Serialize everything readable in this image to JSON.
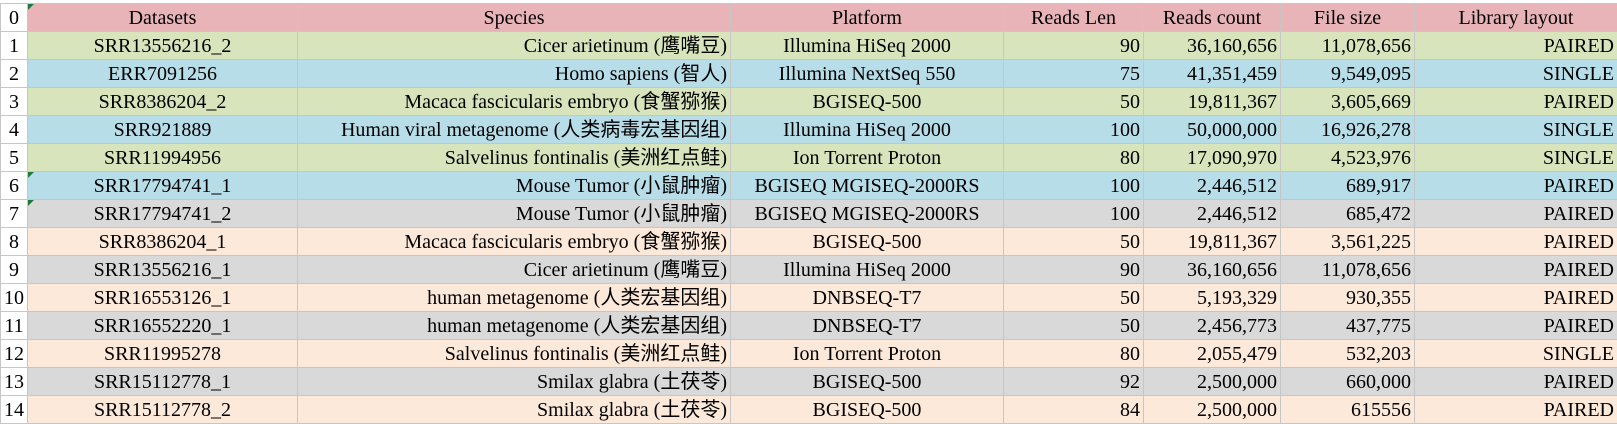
{
  "colors": {
    "header": "#e8b4b8",
    "green": "#d8e4bc",
    "blue": "#b7dde8",
    "gray": "#d9d9d9",
    "peach": "#fde9d9",
    "index": "#ffffff",
    "marker": "#1e7a3a"
  },
  "sheet": {
    "header_index": "0",
    "columns": [
      "Datasets",
      "Species",
      "Platform",
      "Reads Len",
      "Reads count",
      "File size",
      "Library layout"
    ],
    "rows": [
      {
        "index": "1",
        "color": "green",
        "cells": [
          "SRR13556216_2",
          "Cicer arietinum (鹰嘴豆)",
          "Illumina HiSeq 2000",
          "90",
          "36,160,656",
          "11,078,656",
          "PAIRED"
        ]
      },
      {
        "index": "2",
        "color": "blue",
        "cells": [
          "ERR7091256",
          "Homo sapiens (智人)",
          "Illumina NextSeq 550",
          "75",
          "41,351,459",
          "9,549,095",
          "SINGLE"
        ]
      },
      {
        "index": "3",
        "color": "green",
        "cells": [
          "SRR8386204_2",
          "Macaca fascicularis embryo (食蟹猕猴)",
          "BGISEQ-500",
          "50",
          "19,811,367",
          "3,605,669",
          "PAIRED"
        ]
      },
      {
        "index": "4",
        "color": "blue",
        "cells": [
          "SRR921889",
          "Human viral metagenome (人类病毒宏基因组)",
          "Illumina HiSeq 2000",
          "100",
          "50,000,000",
          "16,926,278",
          "SINGLE"
        ]
      },
      {
        "index": "5",
        "color": "green",
        "cells": [
          "SRR11994956",
          "Salvelinus fontinalis (美洲红点鲑)",
          "Ion Torrent Proton",
          "80",
          "17,090,970",
          "4,523,976",
          "SINGLE"
        ]
      },
      {
        "index": "6",
        "color": "blue",
        "cells": [
          "SRR17794741_1",
          "Mouse Tumor (小鼠肿瘤)",
          "BGISEQ MGISEQ-2000RS",
          "100",
          "2,446,512",
          "689,917",
          "PAIRED"
        ]
      },
      {
        "index": "7",
        "color": "gray",
        "cells": [
          "SRR17794741_2",
          "Mouse Tumor (小鼠肿瘤)",
          "BGISEQ MGISEQ-2000RS",
          "100",
          "2,446,512",
          "685,472",
          "PAIRED"
        ]
      },
      {
        "index": "8",
        "color": "peach",
        "cells": [
          "SRR8386204_1",
          "Macaca fascicularis embryo (食蟹猕猴)",
          "BGISEQ-500",
          "50",
          "19,811,367",
          "3,561,225",
          "PAIRED"
        ]
      },
      {
        "index": "9",
        "color": "gray",
        "cells": [
          "SRR13556216_1",
          "Cicer arietinum (鹰嘴豆)",
          "Illumina HiSeq 2000",
          "90",
          "36,160,656",
          "11,078,656",
          "PAIRED"
        ]
      },
      {
        "index": "10",
        "color": "peach",
        "cells": [
          "SRR16553126_1",
          "human metagenome (人类宏基因组)",
          "DNBSEQ-T7",
          "50",
          "5,193,329",
          "930,355",
          "PAIRED"
        ]
      },
      {
        "index": "11",
        "color": "gray",
        "cells": [
          "SRR16552220_1",
          "human metagenome (人类宏基因组)",
          "DNBSEQ-T7",
          "50",
          "2,456,773",
          "437,775",
          "PAIRED"
        ]
      },
      {
        "index": "12",
        "color": "peach",
        "cells": [
          "SRR11995278",
          "Salvelinus fontinalis (美洲红点鲑)",
          "Ion Torrent Proton",
          "80",
          "2,055,479",
          "532,203",
          "SINGLE"
        ]
      },
      {
        "index": "13",
        "color": "gray",
        "cells": [
          "SRR15112778_1",
          "Smilax glabra (土茯苓)",
          "BGISEQ-500",
          "92",
          "2,500,000",
          "660,000",
          "PAIRED"
        ]
      },
      {
        "index": "14",
        "color": "peach",
        "cells": [
          "SRR15112778_2",
          "Smilax glabra (土茯苓)",
          "BGISEQ-500",
          "84",
          "2,500,000",
          "615556",
          "PAIRED"
        ]
      }
    ]
  }
}
